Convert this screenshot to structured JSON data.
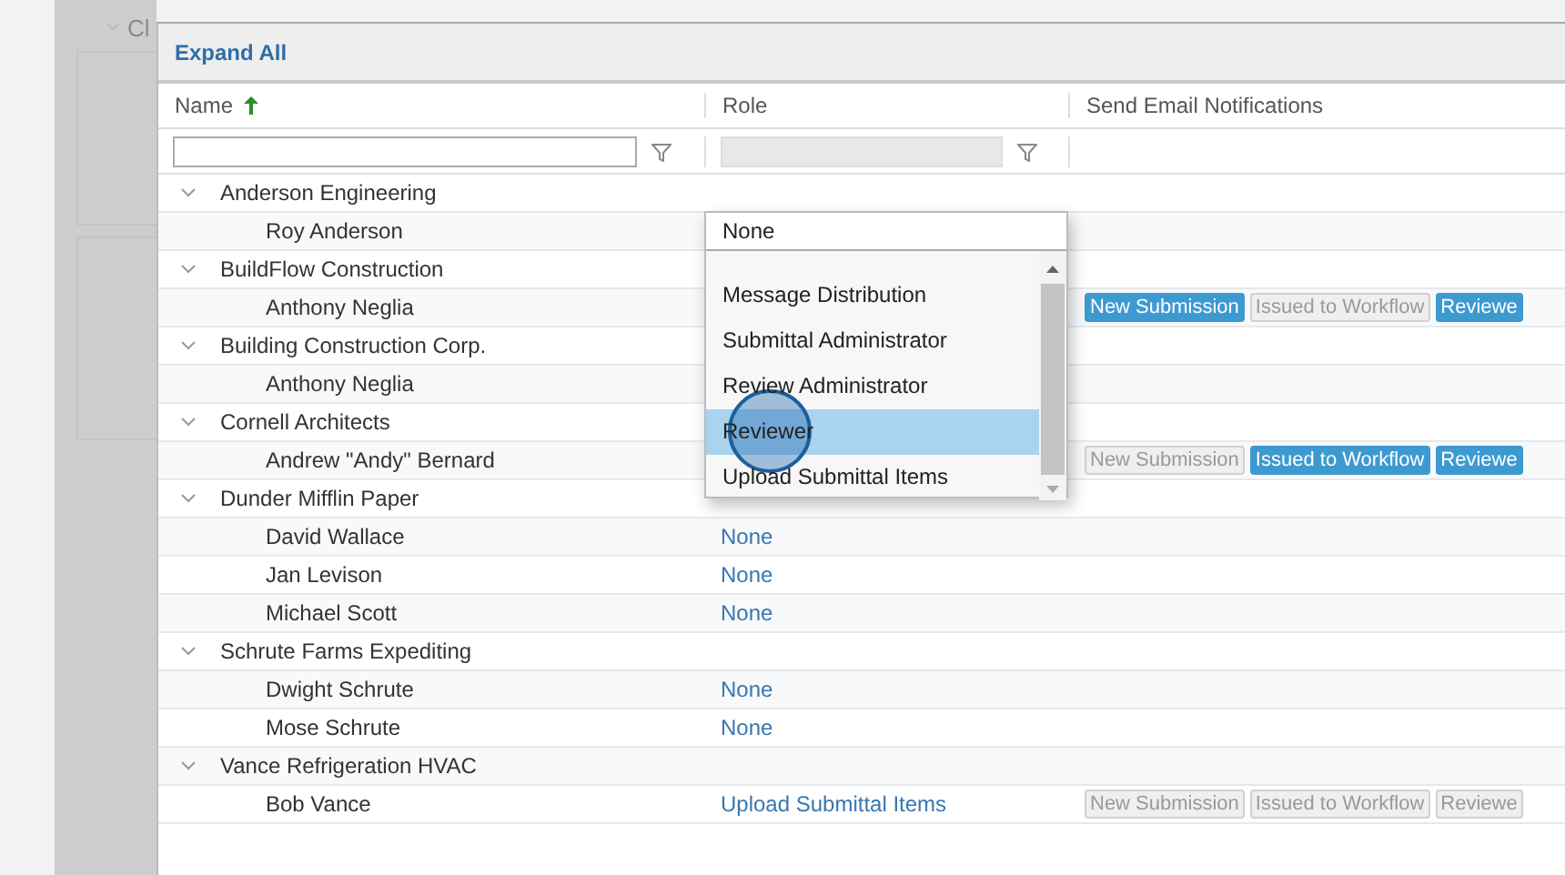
{
  "background": {
    "section_label": "Cl",
    "expanded": true
  },
  "toolbar": {
    "expand_all": "Expand All"
  },
  "table": {
    "columns": [
      {
        "label": "Name",
        "sorted_ascending": true,
        "filter": {
          "disabled": false
        }
      },
      {
        "label": "Role",
        "filter": {
          "disabled": true
        }
      },
      {
        "label": "Send Email Notifications"
      }
    ],
    "groups": [
      {
        "name": "Anderson Engineering",
        "expanded": true,
        "children": [
          {
            "name": "Roy Anderson"
          }
        ]
      },
      {
        "name": "BuildFlow Construction",
        "expanded": true,
        "children": [
          {
            "name": "Anthony Neglia",
            "notifications": [
              {
                "label": "New Submission",
                "on": true
              },
              {
                "label": "Issued to Workflow",
                "on": false
              },
              {
                "label": "Reviewe",
                "on": true
              }
            ]
          }
        ]
      },
      {
        "name": "Building Construction Corp.",
        "expanded": true,
        "children": [
          {
            "name": "Anthony Neglia"
          }
        ]
      },
      {
        "name": "Cornell Architects",
        "expanded": true,
        "children": [
          {
            "name": "Andrew \"Andy\" Bernard",
            "notifications": [
              {
                "label": "New Submission",
                "on": false
              },
              {
                "label": "Issued to Workflow",
                "on": true
              },
              {
                "label": "Reviewe",
                "on": true
              }
            ]
          }
        ]
      },
      {
        "name": "Dunder Mifflin Paper",
        "expanded": true,
        "children": [
          {
            "name": "David Wallace",
            "role": "None"
          },
          {
            "name": "Jan Levison",
            "role": "None"
          },
          {
            "name": "Michael Scott",
            "role": "None"
          }
        ]
      },
      {
        "name": "Schrute Farms Expediting",
        "expanded": true,
        "children": [
          {
            "name": "Dwight Schrute",
            "role": "None"
          },
          {
            "name": "Mose Schrute",
            "role": "None"
          }
        ]
      },
      {
        "name": "Vance Refrigeration HVAC",
        "expanded": true,
        "children": [
          {
            "name": "Bob Vance",
            "role": "Upload Submittal Items",
            "notifications": [
              {
                "label": "New Submission",
                "on": false
              },
              {
                "label": "Issued to Workflow",
                "on": false
              },
              {
                "label": "Reviewe",
                "on": false
              }
            ]
          }
        ]
      }
    ]
  },
  "role_dropdown": {
    "value": "None",
    "options": [
      {
        "label": "Message Distribution",
        "selected": false
      },
      {
        "label": "Submittal Administrator",
        "selected": false
      },
      {
        "label": "Review Administrator",
        "selected": false
      },
      {
        "label": "Reviewer",
        "selected": true
      },
      {
        "label": "Upload Submittal Items",
        "selected": false
      }
    ]
  }
}
